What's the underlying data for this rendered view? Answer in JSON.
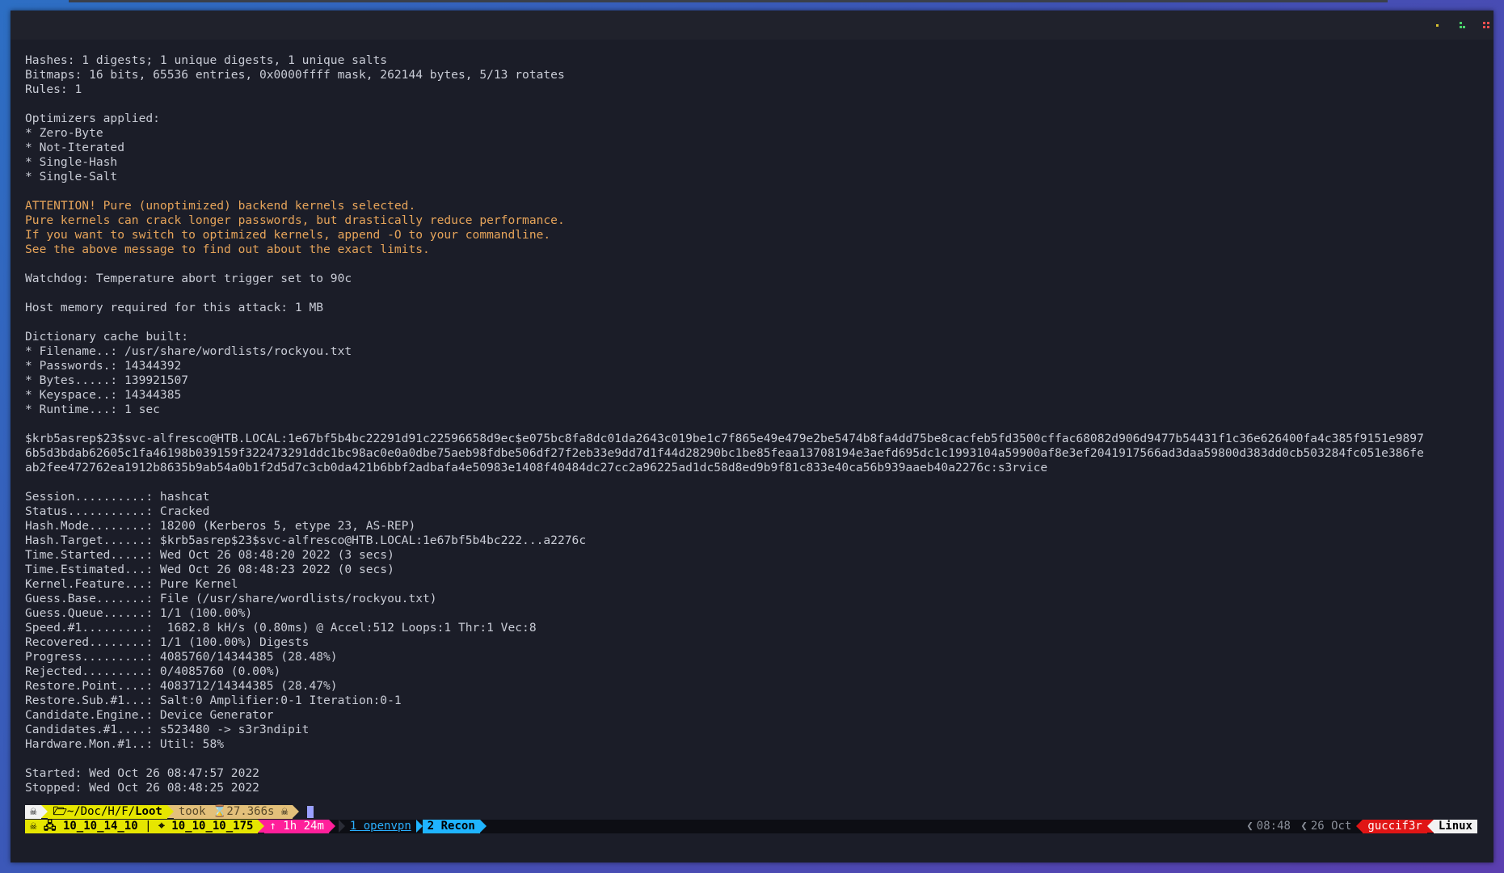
{
  "terminal": {
    "lines": [
      {
        "text": "Hashes: 1 digests; 1 unique digests, 1 unique salts",
        "style": "normal"
      },
      {
        "text": "Bitmaps: 16 bits, 65536 entries, 0x0000ffff mask, 262144 bytes, 5/13 rotates",
        "style": "normal"
      },
      {
        "text": "Rules: 1",
        "style": "normal"
      },
      {
        "text": "",
        "style": "normal"
      },
      {
        "text": "Optimizers applied:",
        "style": "normal"
      },
      {
        "text": "* Zero-Byte",
        "style": "normal"
      },
      {
        "text": "* Not-Iterated",
        "style": "normal"
      },
      {
        "text": "* Single-Hash",
        "style": "normal"
      },
      {
        "text": "* Single-Salt",
        "style": "normal"
      },
      {
        "text": "",
        "style": "normal"
      },
      {
        "text": "ATTENTION! Pure (unoptimized) backend kernels selected.",
        "style": "warn"
      },
      {
        "text": "Pure kernels can crack longer passwords, but drastically reduce performance.",
        "style": "warn"
      },
      {
        "text": "If you want to switch to optimized kernels, append -O to your commandline.",
        "style": "warn"
      },
      {
        "text": "See the above message to find out about the exact limits.",
        "style": "warn"
      },
      {
        "text": "",
        "style": "normal"
      },
      {
        "text": "Watchdog: Temperature abort trigger set to 90c",
        "style": "normal"
      },
      {
        "text": "",
        "style": "normal"
      },
      {
        "text": "Host memory required for this attack: 1 MB",
        "style": "normal"
      },
      {
        "text": "",
        "style": "normal"
      },
      {
        "text": "Dictionary cache built:",
        "style": "normal"
      },
      {
        "text": "* Filename..: /usr/share/wordlists/rockyou.txt",
        "style": "normal"
      },
      {
        "text": "* Passwords.: 14344392",
        "style": "normal"
      },
      {
        "text": "* Bytes.....: 139921507",
        "style": "normal"
      },
      {
        "text": "* Keyspace..: 14344385",
        "style": "normal"
      },
      {
        "text": "* Runtime...: 1 sec",
        "style": "normal"
      },
      {
        "text": "",
        "style": "normal"
      },
      {
        "text": "$krb5asrep$23$svc-alfresco@HTB.LOCAL:1e67bf5b4bc22291d91c22596658d9ec$e075bc8fa8dc01da2643c019be1c7f865e49e479e2be5474b8fa4dd75be8cacfeb5fd3500cffac68082d906d9477b54431f1c36e626400fa4c385f9151e9897",
        "style": "normal"
      },
      {
        "text": "6b5d3bdab62605c1fa46198b039159f322473291ddc1bc98ac0e0a0dbe75aeb98fdbe506df27f2eb33e9dd7d1f44d28290bc1be85feaa13708194e3aefd695dc1c1993104a59900af8e3ef2041917566ad3daa59800d383dd0cb503284fc051e386fe",
        "style": "normal"
      },
      {
        "text": "ab2fee472762ea1912b8635b9ab54a0b1f2d5d7c3cb0da421b6bbf2adbafa4e50983e1408f40484dc27cc2a96225ad1dc58d8ed9b9f81c833e40ca56b939aaeb40a2276c:s3rvice",
        "style": "normal"
      },
      {
        "text": "",
        "style": "normal"
      },
      {
        "text": "Session..........: hashcat",
        "style": "normal"
      },
      {
        "text": "Status...........: Cracked",
        "style": "normal"
      },
      {
        "text": "Hash.Mode........: 18200 (Kerberos 5, etype 23, AS-REP)",
        "style": "normal"
      },
      {
        "text": "Hash.Target......: $krb5asrep$23$svc-alfresco@HTB.LOCAL:1e67bf5b4bc222...a2276c",
        "style": "normal"
      },
      {
        "text": "Time.Started.....: Wed Oct 26 08:48:20 2022 (3 secs)",
        "style": "normal"
      },
      {
        "text": "Time.Estimated...: Wed Oct 26 08:48:23 2022 (0 secs)",
        "style": "normal"
      },
      {
        "text": "Kernel.Feature...: Pure Kernel",
        "style": "normal"
      },
      {
        "text": "Guess.Base.......: File (/usr/share/wordlists/rockyou.txt)",
        "style": "normal"
      },
      {
        "text": "Guess.Queue......: 1/1 (100.00%)",
        "style": "normal"
      },
      {
        "text": "Speed.#1.........:  1682.8 kH/s (0.80ms) @ Accel:512 Loops:1 Thr:1 Vec:8",
        "style": "normal"
      },
      {
        "text": "Recovered........: 1/1 (100.00%) Digests",
        "style": "normal"
      },
      {
        "text": "Progress.........: 4085760/14344385 (28.48%)",
        "style": "normal"
      },
      {
        "text": "Rejected.........: 0/4085760 (0.00%)",
        "style": "normal"
      },
      {
        "text": "Restore.Point....: 4083712/14344385 (28.47%)",
        "style": "normal"
      },
      {
        "text": "Restore.Sub.#1...: Salt:0 Amplifier:0-1 Iteration:0-1",
        "style": "normal"
      },
      {
        "text": "Candidate.Engine.: Device Generator",
        "style": "normal"
      },
      {
        "text": "Candidates.#1....: s523480 -> s3r3ndipit",
        "style": "normal"
      },
      {
        "text": "Hardware.Mon.#1..: Util: 58%",
        "style": "normal"
      },
      {
        "text": "",
        "style": "normal"
      },
      {
        "text": "Started: Wed Oct 26 08:47:57 2022",
        "style": "normal"
      },
      {
        "text": "Stopped: Wed Oct 26 08:48:25 2022",
        "style": "normal"
      }
    ]
  },
  "prompt": {
    "skull": "☠",
    "folder_icon": "folder-open-icon",
    "path_prefix": "~/Doc/H/F/",
    "path_current": "Loot",
    "took_label": "took",
    "hourglass": "⌛",
    "duration": "27.366s",
    "skull_end": "☠"
  },
  "statusbar": {
    "local_ip": "10_10_14_10",
    "divider": "|",
    "target_icon": "⌖",
    "target_ip": "10_10_10_175",
    "uptime": "↑ 1h 24m",
    "windows": [
      {
        "label": "1 openvpn",
        "active": false
      },
      {
        "label": "2 Recon",
        "active": true
      }
    ],
    "time": "08:48",
    "date": "26 Oct",
    "user": "guccif3r",
    "os": "Linux"
  },
  "colors": {
    "terminal_bg": "#1b1d28",
    "text": "#c9ccd6",
    "warn": "#e6a45a",
    "yellow": "#e6e600",
    "magenta": "#ff1f9a",
    "cyan": "#1fb4ff",
    "red": "#e01515"
  }
}
